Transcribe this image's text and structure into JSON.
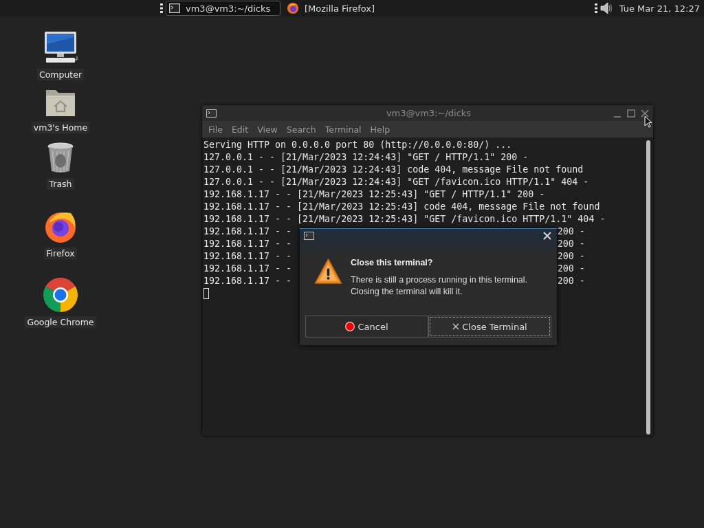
{
  "taskbar": {
    "tasks": [
      {
        "kind": "terminal",
        "label": "vm3@vm3:~/dicks",
        "selected": true
      },
      {
        "kind": "firefox",
        "label": "[Mozilla Firefox]",
        "selected": false
      }
    ],
    "clock": "Tue Mar 21, 12:27"
  },
  "desktop_icons": [
    {
      "kind": "computer",
      "label": "Computer"
    },
    {
      "kind": "home",
      "label": "vm3's Home"
    },
    {
      "kind": "trash",
      "label": "Trash"
    },
    {
      "kind": "firefox",
      "label": "Firefox"
    },
    {
      "kind": "chrome",
      "label": "Google Chrome"
    }
  ],
  "terminal": {
    "title": "vm3@vm3:~/dicks",
    "menu": [
      "File",
      "Edit",
      "View",
      "Search",
      "Terminal",
      "Help"
    ],
    "lines": [
      {
        "text": "Serving HTTP on 0.0.0.0 port 80 (http://0.0.0.0:80/) ..."
      },
      {
        "text": "127.0.0.1 - - [21/Mar/2023 12:24:43] \"GET / HTTP/1.1\" 200 -"
      },
      {
        "text": "127.0.0.1 - - [21/Mar/2023 12:24:43] code 404, message File not found"
      },
      {
        "text": "127.0.0.1 - - [21/Mar/2023 12:24:43] \"GET /favicon.ico HTTP/1.1\" 404 -"
      },
      {
        "text": "192.168.1.17 - - [21/Mar/2023 12:25:43] \"GET / HTTP/1.1\" 200 -"
      },
      {
        "text": "192.168.1.17 - - [21/Mar/2023 12:25:43] code 404, message File not found"
      },
      {
        "text": "192.168.1.17 - - [21/Mar/2023 12:25:43] \"GET /favicon.ico HTTP/1.1\" 404 -"
      },
      {
        "text": "192.168.1.17 - -",
        "tail": "200 -"
      },
      {
        "text": "192.168.1.17 - -",
        "tail": "200 -"
      },
      {
        "text": "192.168.1.17 - -",
        "tail": "200 -"
      },
      {
        "text": "192.168.1.17 - -",
        "tail": "200 -"
      },
      {
        "text": "192.168.1.17 - -",
        "tail": "200 -"
      }
    ]
  },
  "dialog": {
    "heading": "Close this terminal?",
    "message": "There is still a process running in this terminal. Closing the terminal will kill it.",
    "buttons": [
      {
        "kind": "cancel",
        "label": "Cancel",
        "focused": false
      },
      {
        "kind": "close",
        "label": "Close Terminal",
        "focused": true
      }
    ]
  }
}
